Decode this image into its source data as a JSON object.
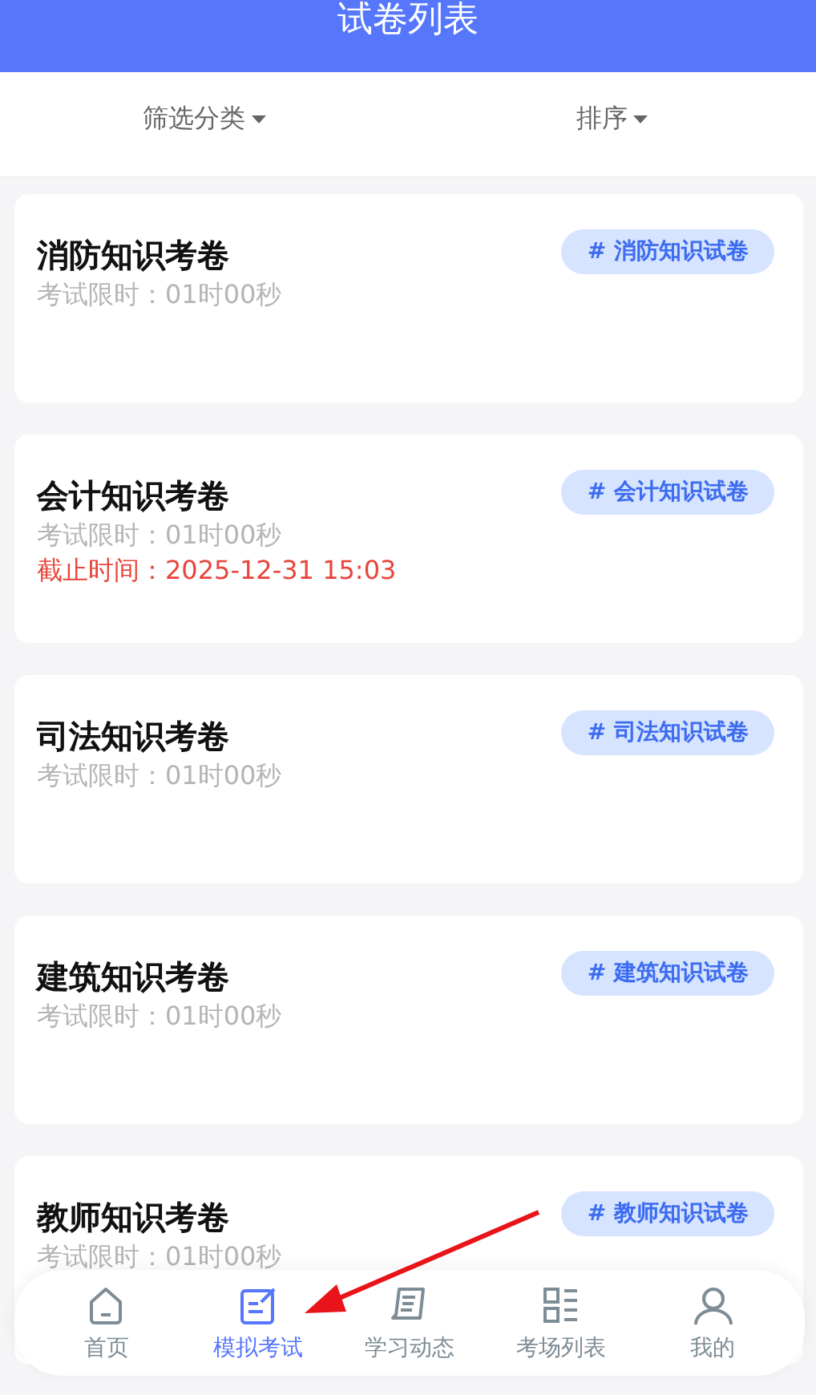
{
  "header": {
    "title": "试卷列表"
  },
  "filters": [
    {
      "label": "筛选分类"
    },
    {
      "label": "排序"
    }
  ],
  "papers": [
    {
      "title": "消防知识考卷",
      "tag": "# 消防知识试卷",
      "time_limit": "考试限时：01时00秒"
    },
    {
      "title": "会计知识考卷",
      "tag": "# 会计知识试卷",
      "time_limit": "考试限时：01时00秒",
      "deadline": "截止时间：2025-12-31 15:03"
    },
    {
      "title": "司法知识考卷",
      "tag": "# 司法知识试卷",
      "time_limit": "考试限时：01时00秒"
    },
    {
      "title": "建筑知识考卷",
      "tag": "# 建筑知识试卷",
      "time_limit": "考试限时：01时00秒"
    },
    {
      "title": "教师知识考卷",
      "tag": "# 教师知识试卷",
      "time_limit": "考试限时：01时00秒"
    }
  ],
  "tab_bar": [
    {
      "label": "首页",
      "kind": "home",
      "selected": false
    },
    {
      "label": "模拟考试",
      "kind": "edit",
      "selected": true
    },
    {
      "label": "学习动态",
      "kind": "scroll",
      "selected": false
    },
    {
      "label": "考场列表",
      "kind": "grid",
      "selected": false
    },
    {
      "label": "我的",
      "kind": "person",
      "selected": false
    }
  ]
}
